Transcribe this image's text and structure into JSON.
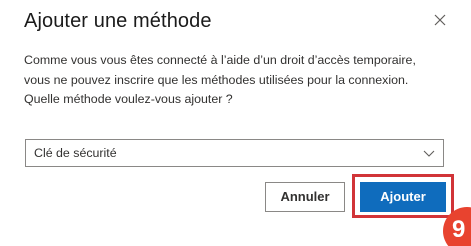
{
  "dialog": {
    "title": "Ajouter une méthode",
    "close_icon": "close-icon",
    "description": "Comme vous vous êtes connecté à l’aide d’un droit d’accès temporaire, vous ne pouvez inscrire que les méthodes utilisées pour la connexion. Quelle méthode voulez-vous ajouter ?",
    "method_select": {
      "selected": "Clé de sécurité",
      "chevron_icon": "chevron-down-icon"
    },
    "buttons": {
      "cancel_label": "Annuler",
      "add_label": "Ajouter"
    }
  },
  "annotation": {
    "step_number": "9",
    "highlight_color": "#d13438",
    "badge_color": "#e8432f"
  },
  "colors": {
    "primary": "#0f6cbd",
    "text": "#323130",
    "border": "#8a8886"
  }
}
